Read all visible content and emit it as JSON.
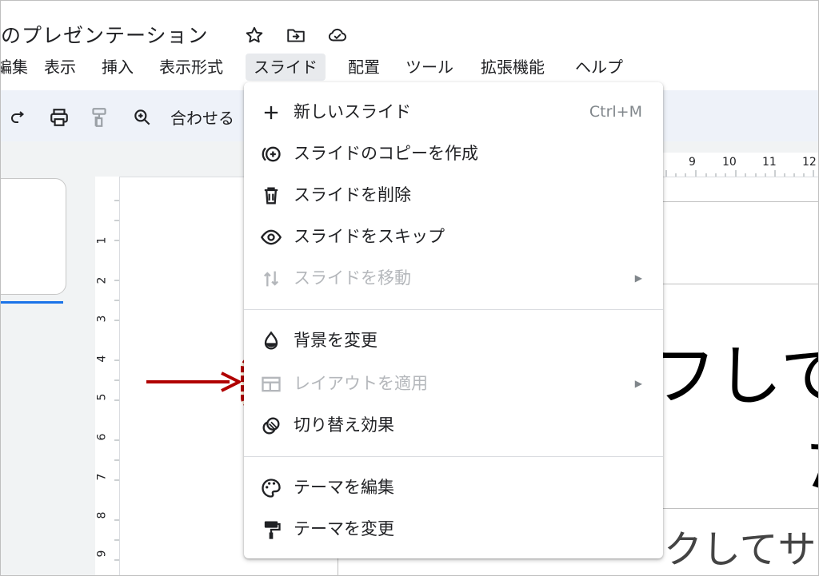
{
  "header": {
    "title": "のプレゼンテーション",
    "icons": [
      "star-icon",
      "move-to-folder-icon",
      "cloud-saved-icon"
    ]
  },
  "menubar": {
    "items": [
      {
        "label": "編集"
      },
      {
        "label": "表示"
      },
      {
        "label": "挿入"
      },
      {
        "label": "表示形式"
      },
      {
        "label": "スライド",
        "active": true
      },
      {
        "label": "配置"
      },
      {
        "label": "ツール"
      },
      {
        "label": "拡張機能"
      },
      {
        "label": "ヘルプ"
      }
    ]
  },
  "toolbar": {
    "zoom_label": "合わせる"
  },
  "rulers": {
    "horizontal": [
      "9",
      "10",
      "11",
      "12"
    ],
    "vertical": [
      "1",
      "2",
      "3",
      "4",
      "5",
      "6",
      "7",
      "8",
      "9"
    ]
  },
  "slide": {
    "title_fragment": "フして",
    "title_fragment2": "た",
    "subtitle_fragment": "クしてサ"
  },
  "dropdown": {
    "items": [
      {
        "label": "新しいスライド",
        "icon": "plus-icon",
        "shortcut": "Ctrl+M"
      },
      {
        "label": "スライドのコピーを作成",
        "icon": "duplicate-slide-icon"
      },
      {
        "label": "スライドを削除",
        "icon": "trash-icon"
      },
      {
        "label": "スライドをスキップ",
        "icon": "eye-icon"
      },
      {
        "label": "スライドを移動",
        "icon": "move-arrows-icon",
        "disabled": true,
        "submenu": true
      },
      {
        "label": "背景を変更",
        "icon": "background-drop-icon"
      },
      {
        "label": "レイアウトを適用",
        "icon": "layout-icon",
        "disabled": true,
        "submenu": true
      },
      {
        "label": "切り替え効果",
        "icon": "transition-icon"
      },
      {
        "label": "テーマを編集",
        "icon": "palette-icon"
      },
      {
        "label": "テーマを変更",
        "icon": "paint-roller-icon"
      }
    ]
  },
  "annotation": {
    "highlight_color": "#b00000"
  }
}
